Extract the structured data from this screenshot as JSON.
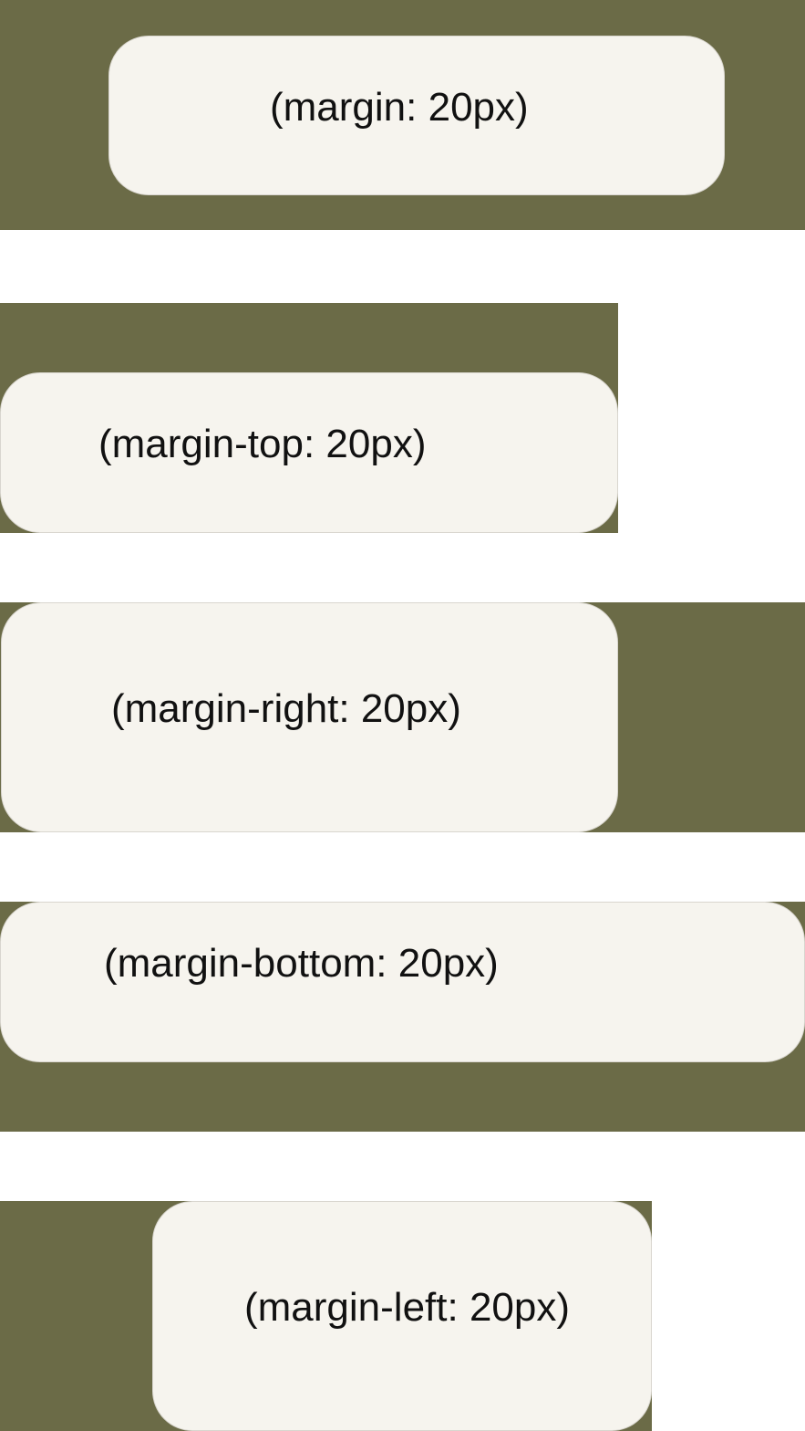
{
  "colors": {
    "outer_background": "#6b6b47",
    "inner_box": "#f6f4ee",
    "page_background": "#ffffff",
    "text": "#111111"
  },
  "demos": [
    {
      "label": "(margin: 20px)"
    },
    {
      "label": "(margin-top: 20px)"
    },
    {
      "label": "(margin-right: 20px)"
    },
    {
      "label": "(margin-bottom: 20px)"
    },
    {
      "label": "(margin-left: 20px)"
    }
  ]
}
